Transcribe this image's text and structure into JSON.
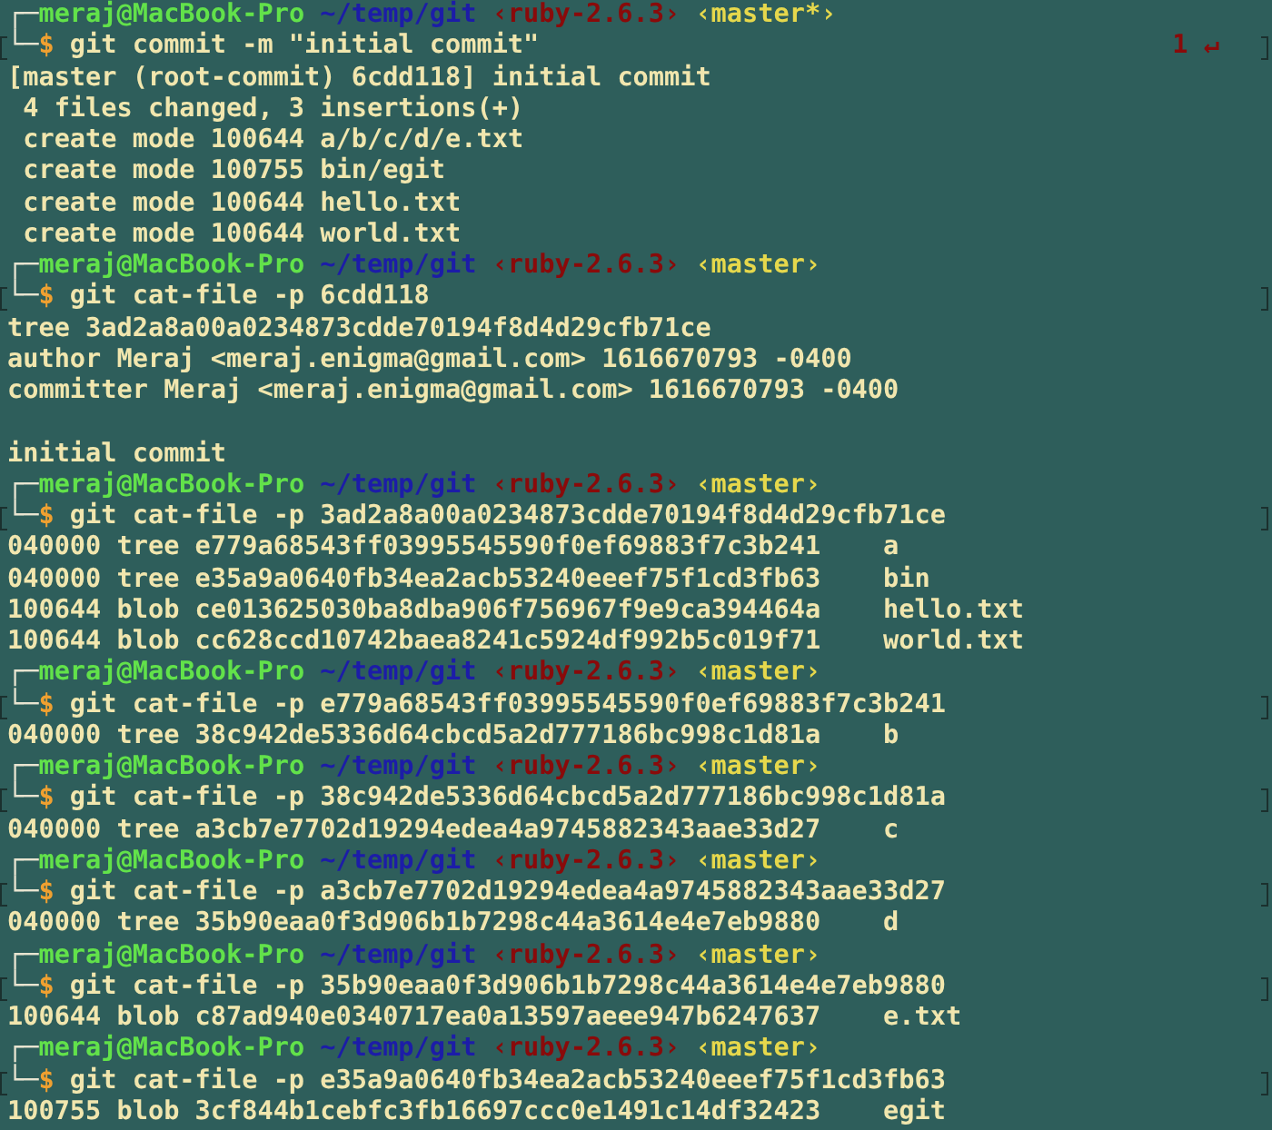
{
  "terminal": {
    "blocks": [
      {
        "prompt": {
          "frame": "┌─",
          "user_host": "meraj@MacBook-Pro",
          "path": "~/temp/git",
          "ruby": "‹ruby-2.6.3›",
          "branch": "‹master*›"
        },
        "command_frame": "└─",
        "symbol": "$",
        "command": "git commit -m \"initial commit\"",
        "marked": true,
        "exit_status": {
          "code": "1",
          "symbol": "↵"
        },
        "output": [
          {
            "kind": "text",
            "text": "[master (root-commit) 6cdd118] initial commit"
          },
          {
            "kind": "text",
            "text": " 4 files changed, 3 insertions(+)"
          },
          {
            "kind": "text",
            "text": " create mode 100644 a/b/c/d/e.txt"
          },
          {
            "kind": "text",
            "text": " create mode 100755 bin/egit"
          },
          {
            "kind": "text",
            "text": " create mode 100644 hello.txt"
          },
          {
            "kind": "text",
            "text": " create mode 100644 world.txt"
          }
        ]
      },
      {
        "prompt": {
          "frame": "┌─",
          "user_host": "meraj@MacBook-Pro",
          "path": "~/temp/git",
          "ruby": "‹ruby-2.6.3›",
          "branch": "‹master›"
        },
        "command_frame": "└─",
        "symbol": "$",
        "command": "git cat-file -p 6cdd118",
        "marked": true,
        "output": [
          {
            "kind": "text",
            "text": "tree 3ad2a8a00a0234873cdde70194f8d4d29cfb71ce"
          },
          {
            "kind": "text",
            "text": "author Meraj <meraj.enigma@gmail.com> 1616670793 -0400"
          },
          {
            "kind": "text",
            "text": "committer Meraj <meraj.enigma@gmail.com> 1616670793 -0400"
          },
          {
            "kind": "blank"
          },
          {
            "kind": "text",
            "text": "initial commit"
          }
        ]
      },
      {
        "prompt": {
          "frame": "┌─",
          "user_host": "meraj@MacBook-Pro",
          "path": "~/temp/git",
          "ruby": "‹ruby-2.6.3›",
          "branch": "‹master›"
        },
        "command_frame": "└─",
        "symbol": "$",
        "command": "git cat-file -p 3ad2a8a00a0234873cdde70194f8d4d29cfb71ce",
        "marked": true,
        "output": [
          {
            "kind": "entry",
            "text": "040000 tree e779a68543ff03995545590f0ef69883f7c3b241",
            "name": "a"
          },
          {
            "kind": "entry",
            "text": "040000 tree e35a9a0640fb34ea2acb53240eeef75f1cd3fb63",
            "name": "bin"
          },
          {
            "kind": "entry",
            "text": "100644 blob ce013625030ba8dba906f756967f9e9ca394464a",
            "name": "hello.txt"
          },
          {
            "kind": "entry",
            "text": "100644 blob cc628ccd10742baea8241c5924df992b5c019f71",
            "name": "world.txt"
          }
        ]
      },
      {
        "prompt": {
          "frame": "┌─",
          "user_host": "meraj@MacBook-Pro",
          "path": "~/temp/git",
          "ruby": "‹ruby-2.6.3›",
          "branch": "‹master›"
        },
        "command_frame": "└─",
        "symbol": "$",
        "command": "git cat-file -p e779a68543ff03995545590f0ef69883f7c3b241",
        "marked": true,
        "output": [
          {
            "kind": "entry",
            "text": "040000 tree 38c942de5336d64cbcd5a2d777186bc998c1d81a",
            "name": "b"
          }
        ]
      },
      {
        "prompt": {
          "frame": "┌─",
          "user_host": "meraj@MacBook-Pro",
          "path": "~/temp/git",
          "ruby": "‹ruby-2.6.3›",
          "branch": "‹master›"
        },
        "command_frame": "└─",
        "symbol": "$",
        "command": "git cat-file -p 38c942de5336d64cbcd5a2d777186bc998c1d81a",
        "marked": true,
        "output": [
          {
            "kind": "entry",
            "text": "040000 tree a3cb7e7702d19294edea4a9745882343aae33d27",
            "name": "c"
          }
        ]
      },
      {
        "prompt": {
          "frame": "┌─",
          "user_host": "meraj@MacBook-Pro",
          "path": "~/temp/git",
          "ruby": "‹ruby-2.6.3›",
          "branch": "‹master›"
        },
        "command_frame": "└─",
        "symbol": "$",
        "command": "git cat-file -p a3cb7e7702d19294edea4a9745882343aae33d27",
        "marked": true,
        "output": [
          {
            "kind": "entry",
            "text": "040000 tree 35b90eaa0f3d906b1b7298c44a3614e4e7eb9880",
            "name": "d"
          }
        ]
      },
      {
        "prompt": {
          "frame": "┌─",
          "user_host": "meraj@MacBook-Pro",
          "path": "~/temp/git",
          "ruby": "‹ruby-2.6.3›",
          "branch": "‹master›"
        },
        "command_frame": "└─",
        "symbol": "$",
        "command": "git cat-file -p 35b90eaa0f3d906b1b7298c44a3614e4e7eb9880",
        "marked": true,
        "output": [
          {
            "kind": "entry",
            "text": "100644 blob c87ad940e0340717ea0a13597aeee947b6247637",
            "name": "e.txt"
          }
        ]
      },
      {
        "prompt": {
          "frame": "┌─",
          "user_host": "meraj@MacBook-Pro",
          "path": "~/temp/git",
          "ruby": "‹ruby-2.6.3›",
          "branch": "‹master›"
        },
        "command_frame": "└─",
        "symbol": "$",
        "command": "git cat-file -p e35a9a0640fb34ea2acb53240eeef75f1cd3fb63",
        "marked": true,
        "output": [
          {
            "kind": "entry",
            "text": "100755 blob 3cf844b1cebfc3fb16697ccc0e1491c14df32423",
            "name": "egit"
          }
        ]
      }
    ]
  }
}
